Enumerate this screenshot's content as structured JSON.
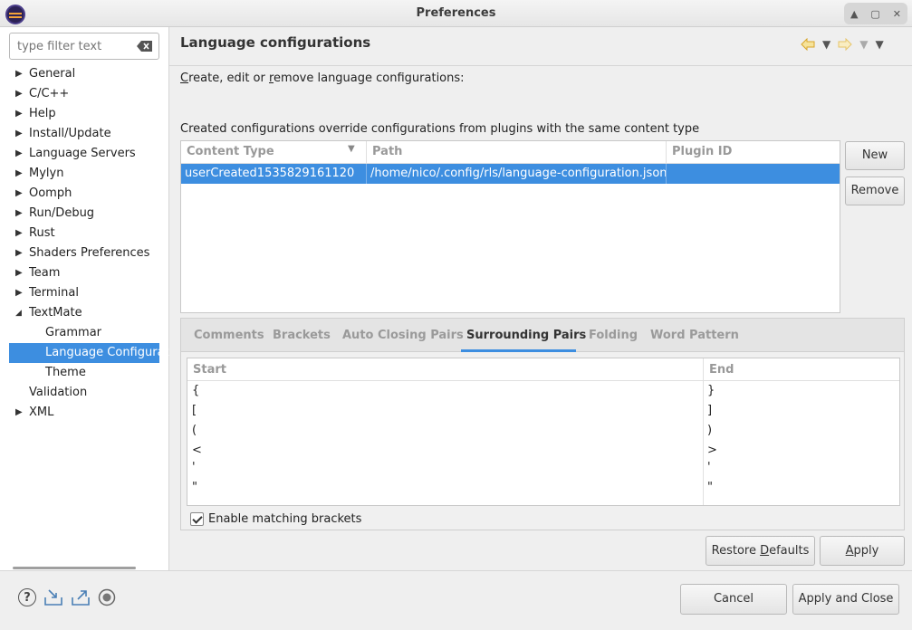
{
  "window": {
    "title": "Preferences"
  },
  "filter": {
    "placeholder": "type filter text"
  },
  "tree": {
    "items": [
      {
        "label": "General",
        "expandable": true
      },
      {
        "label": "C/C++",
        "expandable": true
      },
      {
        "label": "Help",
        "expandable": true
      },
      {
        "label": "Install/Update",
        "expandable": true
      },
      {
        "label": "Language Servers",
        "expandable": true
      },
      {
        "label": "Mylyn",
        "expandable": true
      },
      {
        "label": "Oomph",
        "expandable": true
      },
      {
        "label": "Run/Debug",
        "expandable": true
      },
      {
        "label": "Rust",
        "expandable": true
      },
      {
        "label": "Shaders Preferences",
        "expandable": true
      },
      {
        "label": "Team",
        "expandable": true
      },
      {
        "label": "Terminal",
        "expandable": true
      },
      {
        "label": "TextMate",
        "expanded": true
      },
      {
        "label": "Grammar",
        "child": true
      },
      {
        "label": "Language Configurat",
        "child": true,
        "selected": true
      },
      {
        "label": "Theme",
        "child": true
      },
      {
        "label": "Validation"
      },
      {
        "label": "XML",
        "expandable": true
      }
    ]
  },
  "page": {
    "title": "Language configurations",
    "desc1_pre": "",
    "desc1_c": "C",
    "desc1_mid": "reate, edit or ",
    "desc1_r": "r",
    "desc1_post": "emove language configurations:",
    "desc2": "Created configurations override configurations from plugins with the same content type"
  },
  "config_table": {
    "headers": [
      "Content Type",
      "Path",
      "Plugin ID"
    ],
    "rows": [
      {
        "content_type": "userCreated1535829161120",
        "path": "/home/nico/.config/rls/language-configuration.json",
        "plugin_id": ""
      }
    ]
  },
  "buttons": {
    "new": "New",
    "remove": "Remove",
    "restore_pre": "Restore ",
    "restore_u": "D",
    "restore_post": "efaults",
    "apply_u": "A",
    "apply_post": "pply",
    "cancel": "Cancel",
    "apply_close": "Apply and Close"
  },
  "tabs": [
    "Comments",
    "Brackets",
    "Auto Closing Pairs",
    "Surrounding Pairs",
    "Folding",
    "Word Pattern"
  ],
  "active_tab": "Surrounding Pairs",
  "pairs_table": {
    "headers": [
      "Start",
      "End"
    ],
    "rows": [
      {
        "start": "{",
        "end": "}"
      },
      {
        "start": "[",
        "end": "]"
      },
      {
        "start": "(",
        "end": ")"
      },
      {
        "start": "<",
        "end": ">"
      },
      {
        "start": "'",
        "end": "'"
      },
      {
        "start": "\"",
        "end": "\""
      }
    ]
  },
  "checkbox": {
    "label": "Enable matching brackets",
    "checked": true
  },
  "colors": {
    "selection": "#3d8ee0",
    "accent_nav": "#e8b23a"
  },
  "footer_icons": [
    "help-icon",
    "import-icon",
    "export-icon",
    "record-icon"
  ]
}
